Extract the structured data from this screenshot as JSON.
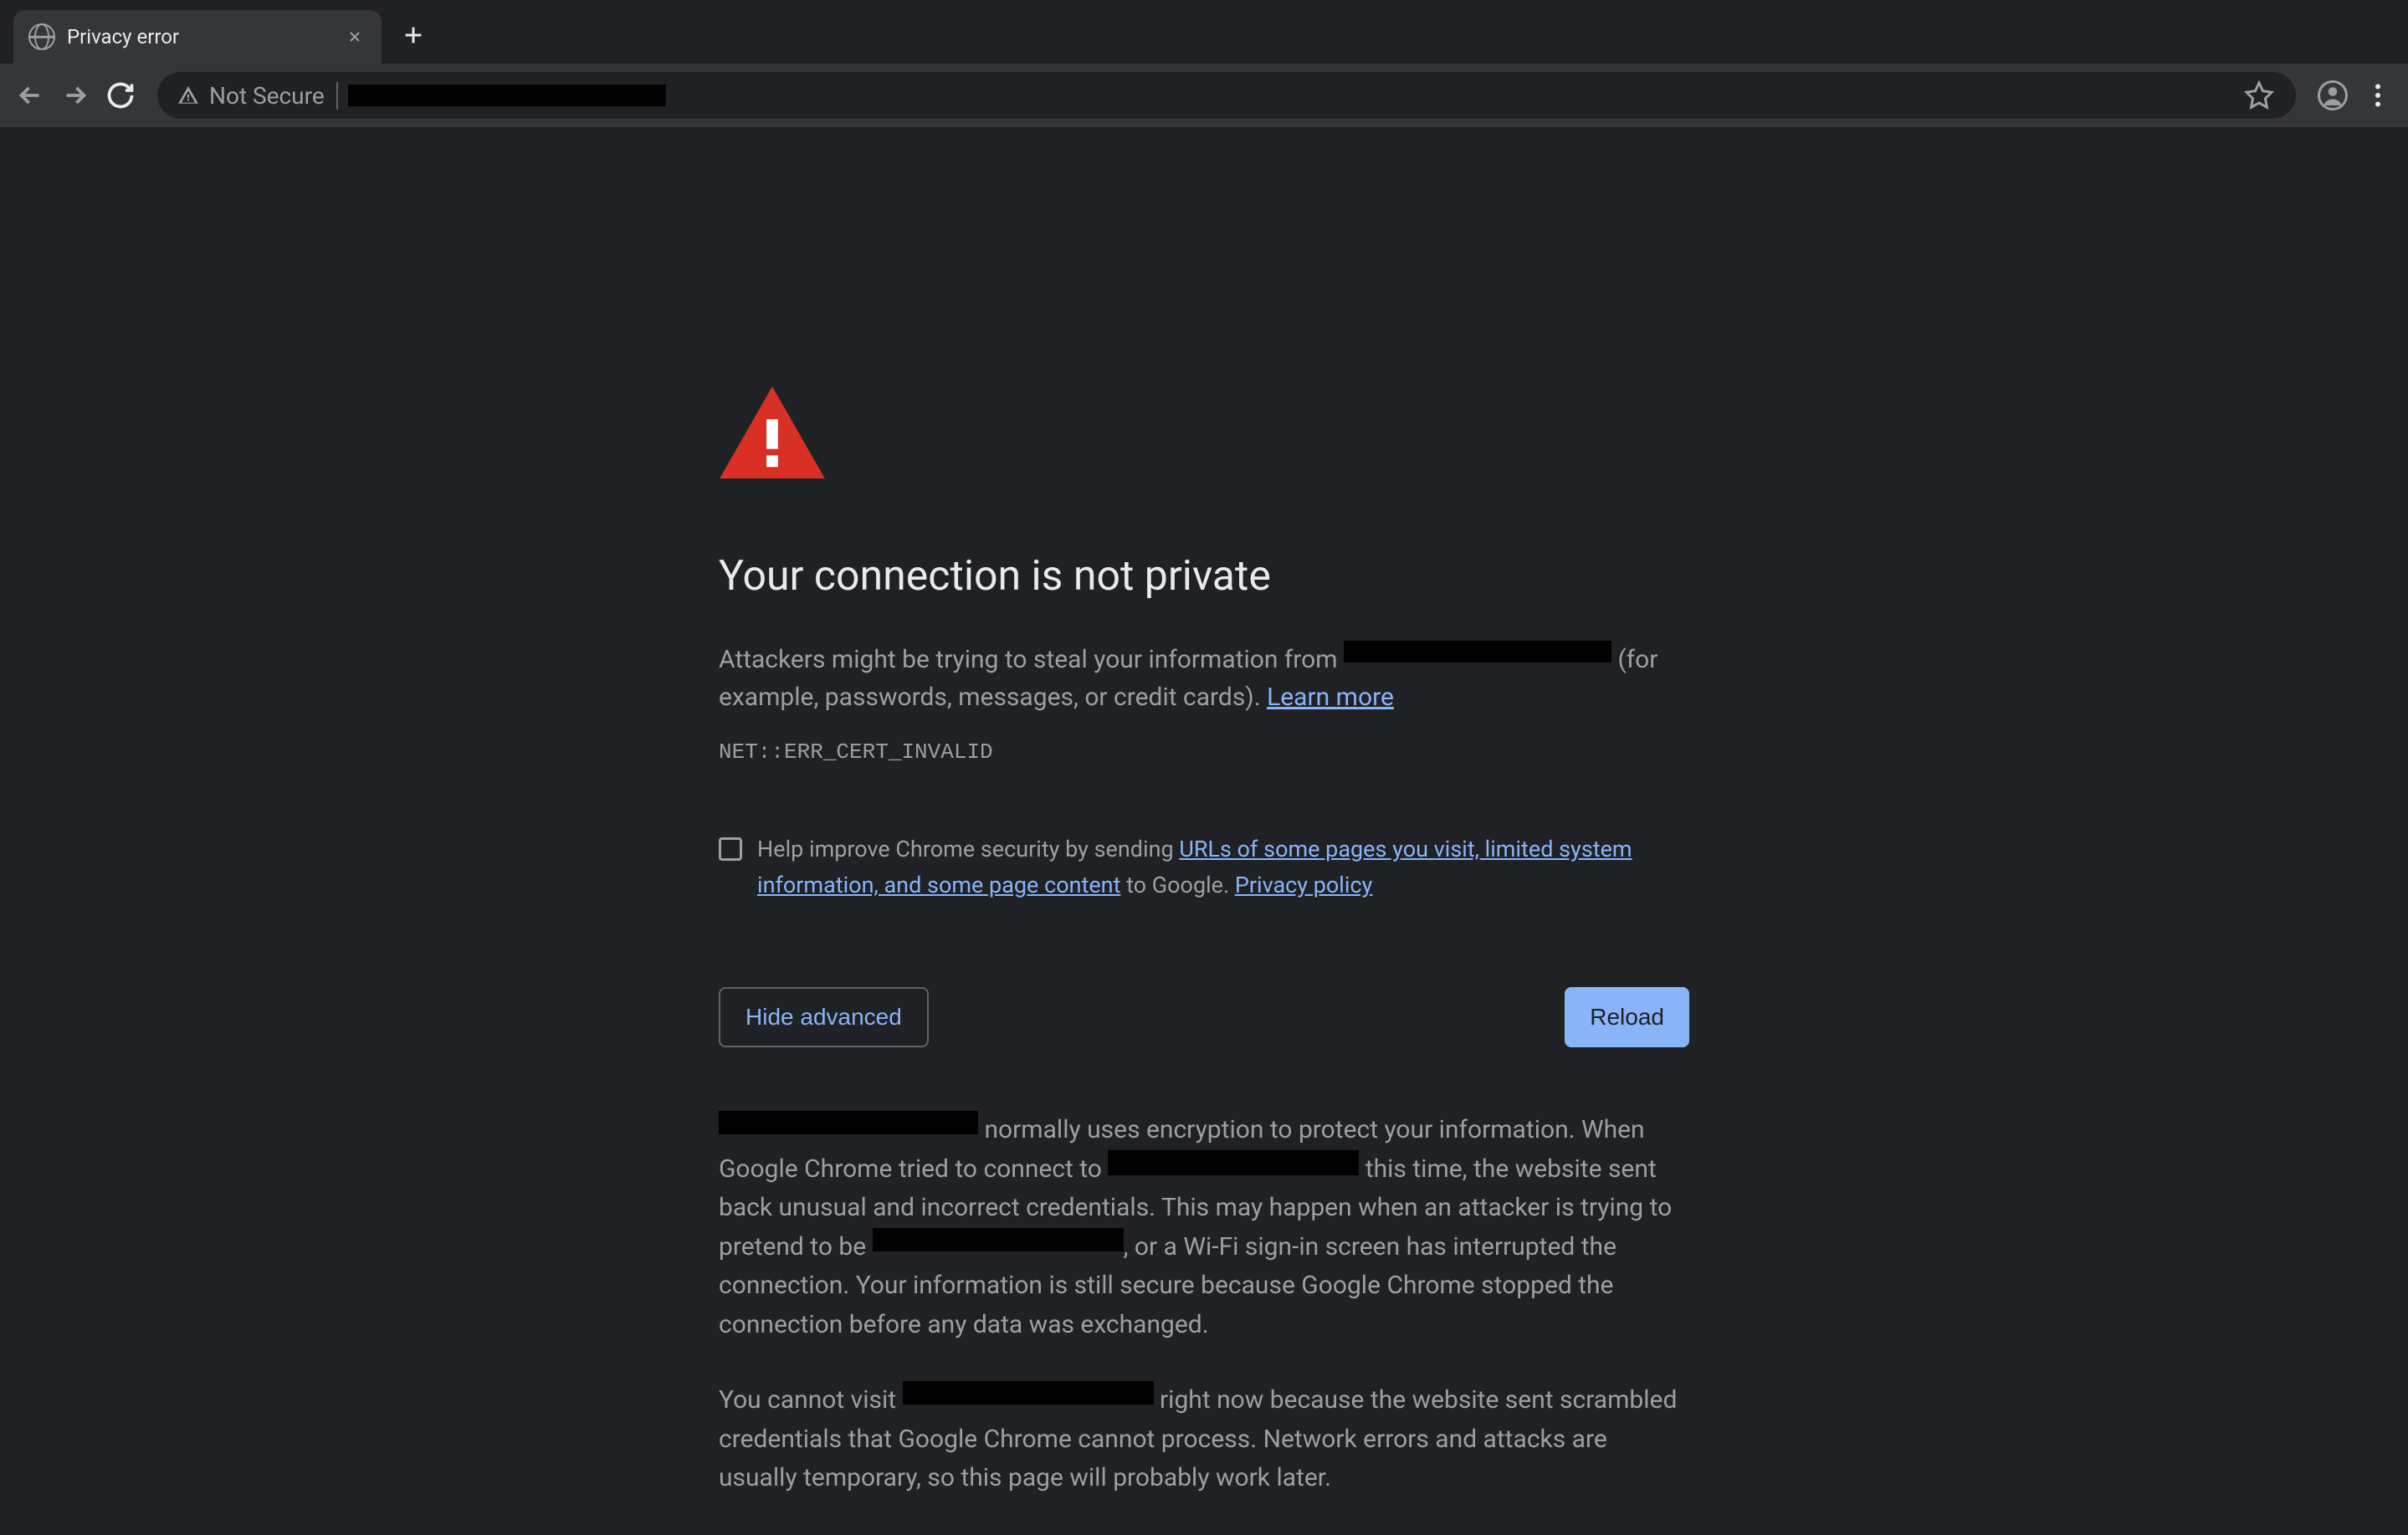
{
  "tab": {
    "title": "Privacy error"
  },
  "toolbar": {
    "security_label": "Not Secure"
  },
  "error": {
    "heading": "Your connection is not private",
    "desc_before": "Attackers might be trying to steal your information from ",
    "desc_after": " (for example, passwords, messages, or credit cards). ",
    "learn_more": "Learn more",
    "error_code": "NET::ERR_CERT_INVALID",
    "help_prefix": "Help improve Chrome security by sending ",
    "help_link": "URLs of some pages you visit, limited system information, and some page content",
    "help_suffix": " to Google. ",
    "privacy_policy": "Privacy policy",
    "hide_advanced": "Hide advanced",
    "reload": "Reload",
    "adv1_mid1": " normally uses encryption to protect your information. When Google Chrome tried to connect to ",
    "adv1_mid2": " this time, the website sent back unusual and incorrect credentials. This may happen when an attacker is trying to pretend to be ",
    "adv1_mid3": ", or a Wi-Fi sign-in screen has interrupted the connection. Your information is still secure because Google Chrome stopped the connection before any data was exchanged.",
    "adv2_prefix": "You cannot visit ",
    "adv2_suffix": " right now because the website sent scrambled credentials that Google Chrome cannot process. Network errors and attacks are usually temporary, so this page will probably work later."
  }
}
